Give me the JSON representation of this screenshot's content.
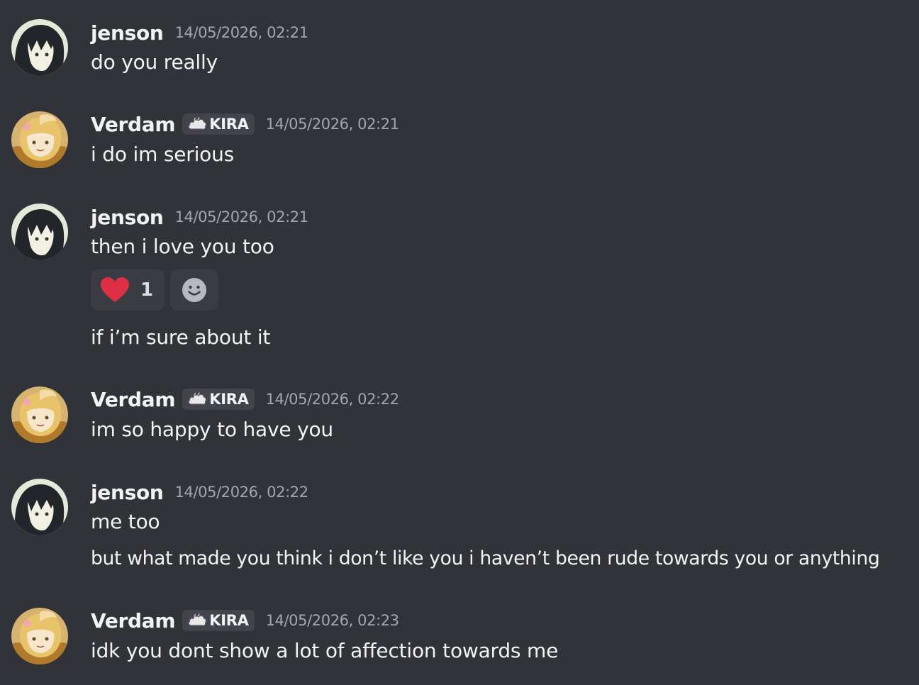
{
  "messages": [
    {
      "author": "jenson",
      "timestamp": "14/05/2026, 02:21",
      "avatar_icon": "dark-hair-avatar",
      "lines": [
        "do you really"
      ]
    },
    {
      "author": "Verdam",
      "tag": "KIRA",
      "tag_icon": "cloud-icon",
      "timestamp": "14/05/2026, 02:21",
      "avatar_icon": "blonde-avatar",
      "lines": [
        "i do im serious"
      ]
    },
    {
      "author": "jenson",
      "timestamp": "14/05/2026, 02:21",
      "avatar_icon": "dark-hair-avatar",
      "lines": [
        "then i love you too"
      ],
      "reactions": [
        {
          "emoji": "heart-icon",
          "count": "1"
        },
        {
          "emoji": "add-reaction-icon"
        }
      ],
      "extra_line": "if i’m sure about it"
    },
    {
      "author": "Verdam",
      "tag": "KIRA",
      "tag_icon": "cloud-icon",
      "timestamp": "14/05/2026, 02:22",
      "avatar_icon": "blonde-avatar",
      "lines": [
        "im so happy to have you"
      ]
    },
    {
      "author": "jenson",
      "timestamp": "14/05/2026, 02:22",
      "avatar_icon": "dark-hair-avatar",
      "lines": [
        "me too",
        "but what made you think i don’t like you i haven’t been rude towards you or anything"
      ]
    },
    {
      "author": "Verdam",
      "tag": "KIRA",
      "tag_icon": "cloud-icon",
      "timestamp": "14/05/2026, 02:23",
      "avatar_icon": "blonde-avatar",
      "lines": [
        "idk you dont show a lot of affection towards me"
      ]
    }
  ],
  "colors": {
    "background": "#323338",
    "username": "#f2f3f5",
    "timestamp": "#a4a6ad",
    "tag_bg": "#43444b",
    "reaction_bg": "#3b3c43",
    "heart": "#dd2e44"
  }
}
